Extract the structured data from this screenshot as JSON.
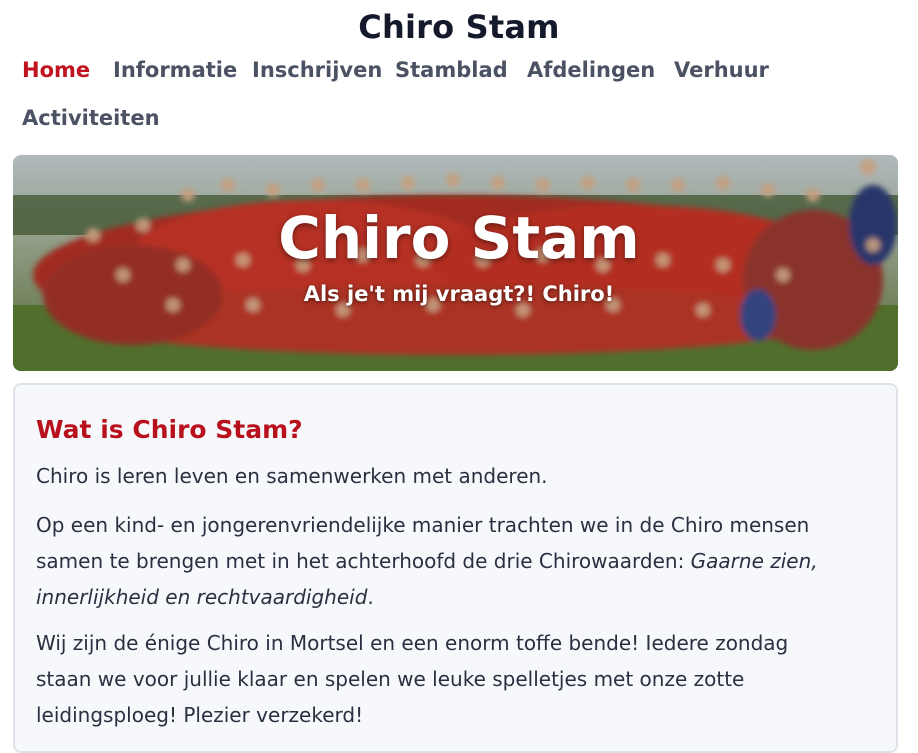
{
  "site": {
    "title": "Chiro Stam"
  },
  "nav": {
    "items": [
      {
        "label": "Home",
        "active": true
      },
      {
        "label": "Informatie",
        "active": false
      },
      {
        "label": "Inschrijven",
        "active": false
      },
      {
        "label": "Stamblad",
        "active": false
      },
      {
        "label": "Afdelingen",
        "active": false
      },
      {
        "label": "Verhuur",
        "active": false
      },
      {
        "label": "Activiteiten",
        "active": false
      }
    ]
  },
  "hero": {
    "title": "Chiro Stam",
    "subtitle": "Als je't mij vraagt?! Chiro!"
  },
  "intro": {
    "heading": "Wat is Chiro Stam?",
    "p1": "Chiro is leren leven en samenwerken met anderen.",
    "p2_line1": "Op een kind- en jongerenvriendelijke manier trachten we in de Chiro mensen",
    "p2_line2_prefix": "samen te brengen met in het achterhoofd de drie Chirowaarden: ",
    "p2_line2_em": "Gaarne zien,",
    "p2_line3_em": "innerlijkheid en rechtvaardigheid",
    "p2_line3_suffix": ".",
    "p3_line1": "Wij zijn de énige Chiro in Mortsel en een enorm toffe bende! Iedere zondag",
    "p3_line2": "staan we voor jullie klaar en spelen we leuke spelletjes met onze zotte",
    "p3_line3": "leidingsploeg! Plezier verzekerd!"
  },
  "colors": {
    "accent": "#c1121f",
    "heading": "#b8111d",
    "nav_text": "#4a5263",
    "card_bg": "#f6f8fb"
  }
}
